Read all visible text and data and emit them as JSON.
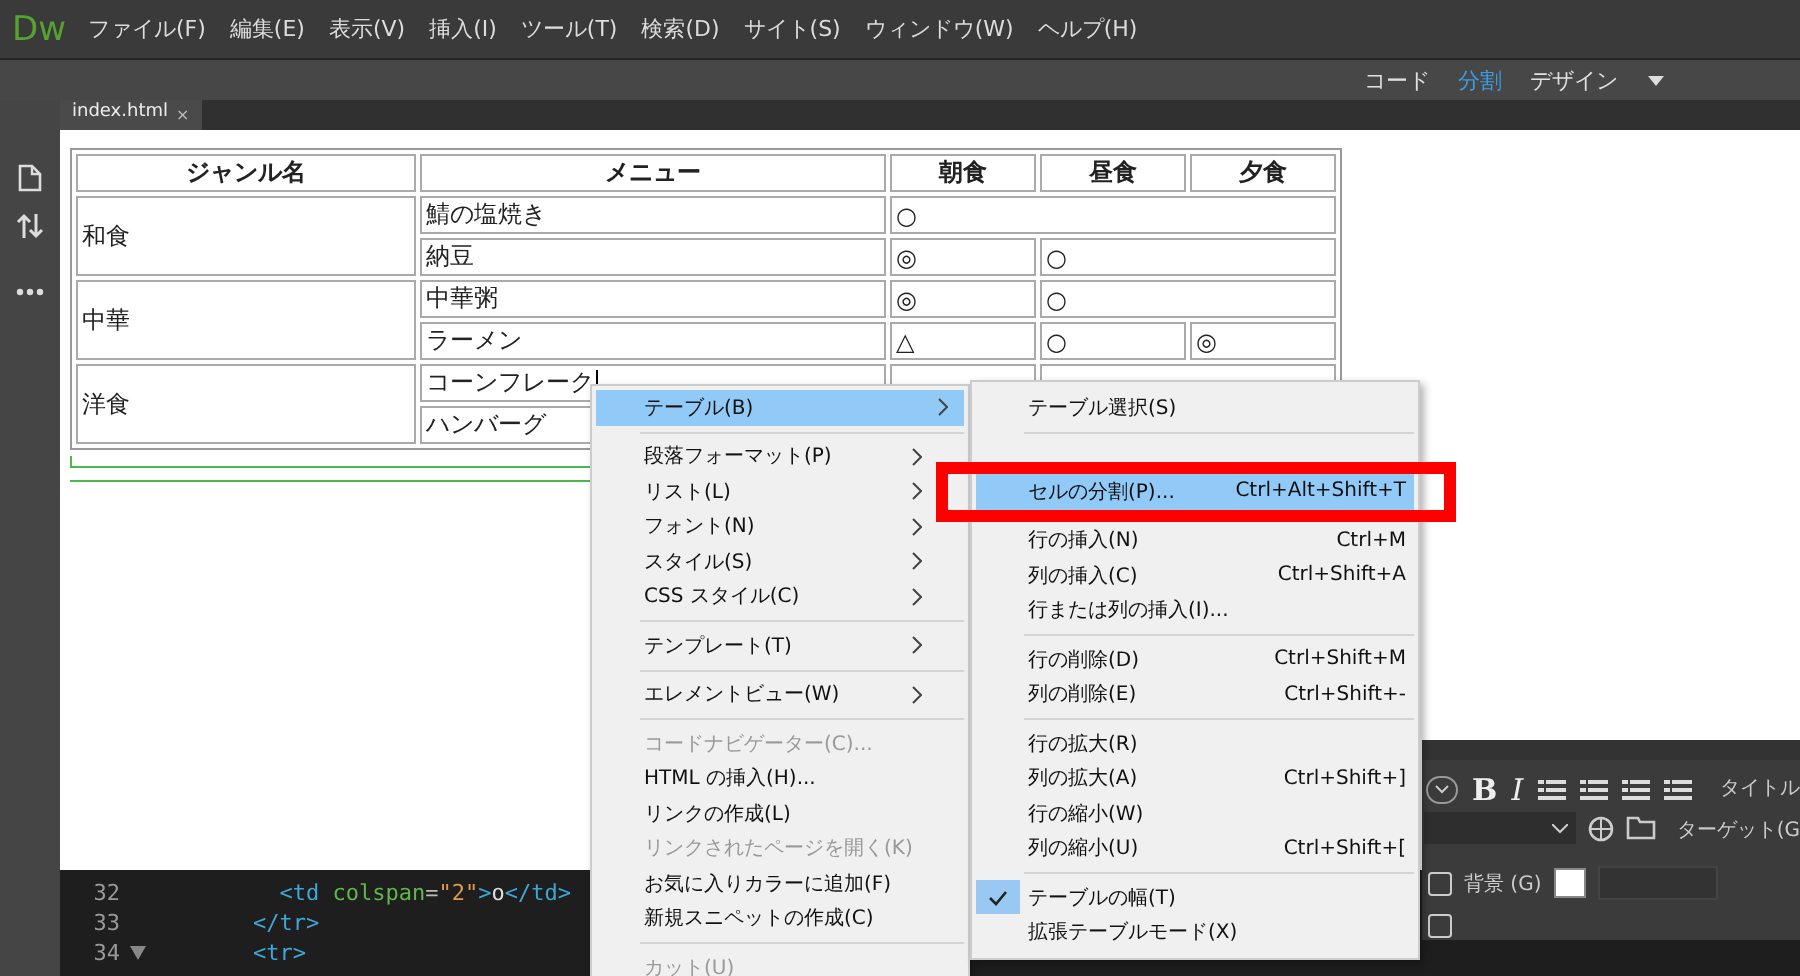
{
  "app": {
    "logo": "Dw"
  },
  "menu_bar": [
    "ファイル(F)",
    "編集(E)",
    "表示(V)",
    "挿入(I)",
    "ツール(T)",
    "検索(D)",
    "サイト(S)",
    "ウィンドウ(W)",
    "ヘルプ(H)"
  ],
  "view_switch": [
    {
      "label": "コード",
      "selected": false
    },
    {
      "label": "分割",
      "selected": true
    },
    {
      "label": "デザイン",
      "selected": false
    }
  ],
  "document_tab": {
    "label": "index.html",
    "close": "×"
  },
  "table": {
    "columns": [
      "ジャンル名",
      "メニュー",
      "朝食",
      "昼食",
      "夕食"
    ],
    "groups": [
      {
        "genre": "和食",
        "rows": [
          {
            "menu": "鯖の塩焼き",
            "cursor": false,
            "cells": [
              {
                "colspan": 3,
                "text": "○"
              }
            ]
          },
          {
            "menu": "納豆",
            "cursor": false,
            "cells": [
              {
                "text": "◎"
              },
              {
                "colspan": 2,
                "text": "○"
              }
            ]
          }
        ]
      },
      {
        "genre": "中華",
        "rows": [
          {
            "menu": "中華粥",
            "cursor": false,
            "cells": [
              {
                "text": "◎"
              },
              {
                "colspan": 2,
                "text": "○"
              }
            ]
          },
          {
            "menu": "ラーメン",
            "cursor": false,
            "cells": [
              {
                "text": "△"
              },
              {
                "text": "○"
              },
              {
                "text": "◎"
              }
            ]
          }
        ]
      },
      {
        "genre": "洋食",
        "rows": [
          {
            "menu": "コーンフレーク",
            "cursor": true,
            "cells": [
              {},
              {
                "colspan": 2
              }
            ]
          },
          {
            "menu": "ハンバーグ",
            "cursor": false
          }
        ]
      }
    ]
  },
  "code_lines": [
    {
      "number": "32",
      "foldable": false,
      "tokens": [
        {
          "kind": "tag",
          "text": "      <td"
        },
        {
          "kind": "attr",
          "text": " colspan"
        },
        {
          "kind": "punct",
          "text": "="
        },
        {
          "kind": "string",
          "text": "\"2\""
        },
        {
          "kind": "tag",
          "text": ">"
        },
        {
          "kind": "text",
          "text": "o"
        },
        {
          "kind": "tag",
          "text": "</td>"
        }
      ]
    },
    {
      "number": "33",
      "foldable": false,
      "tokens": [
        {
          "kind": "tag",
          "text": "    </tr>"
        }
      ]
    },
    {
      "number": "34",
      "foldable": true,
      "tokens": [
        {
          "kind": "tag",
          "text": "    <tr>"
        }
      ]
    }
  ],
  "properties": {
    "bold": "B",
    "italic": "I",
    "title_label": "タイトル",
    "target_label": "ターゲット(G",
    "background_label": "背景 (G)",
    "checkboxes": [
      {
        "checked": false
      },
      {
        "checked": false
      }
    ]
  },
  "context_menu": [
    {
      "kind": "item",
      "label": "テーブル(B)",
      "submenu": true,
      "disabled": false,
      "selected": true
    },
    {
      "kind": "separator"
    },
    {
      "kind": "item",
      "label": "段落フォーマット(P)",
      "submenu": true,
      "disabled": false,
      "selected": false
    },
    {
      "kind": "item",
      "label": "リスト(L)",
      "submenu": true,
      "disabled": false,
      "selected": false
    },
    {
      "kind": "item",
      "label": "フォント(N)",
      "submenu": true,
      "disabled": false,
      "selected": false
    },
    {
      "kind": "item",
      "label": "スタイル(S)",
      "submenu": true,
      "disabled": false,
      "selected": false
    },
    {
      "kind": "item",
      "label": "CSS スタイル(C)",
      "submenu": true,
      "disabled": false,
      "selected": false
    },
    {
      "kind": "separator"
    },
    {
      "kind": "item",
      "label": "テンプレート(T)",
      "submenu": true,
      "disabled": false,
      "selected": false
    },
    {
      "kind": "separator"
    },
    {
      "kind": "item",
      "label": "エレメントビュー(W)",
      "submenu": true,
      "disabled": false,
      "selected": false
    },
    {
      "kind": "separator"
    },
    {
      "kind": "item",
      "label": "コードナビゲーター(C)...",
      "submenu": false,
      "disabled": true,
      "selected": false
    },
    {
      "kind": "item",
      "label": "HTML の挿入(H)...",
      "submenu": false,
      "disabled": false,
      "selected": false
    },
    {
      "kind": "item",
      "label": "リンクの作成(L)",
      "submenu": false,
      "disabled": false,
      "selected": false
    },
    {
      "kind": "item",
      "label": "リンクされたページを開く(K)",
      "submenu": false,
      "disabled": true,
      "selected": false
    },
    {
      "kind": "item",
      "label": "お気に入りカラーに追加(F)",
      "submenu": false,
      "disabled": false,
      "selected": false
    },
    {
      "kind": "item",
      "label": "新規スニペットの作成(C)",
      "submenu": false,
      "disabled": false,
      "selected": false
    },
    {
      "kind": "separator"
    },
    {
      "kind": "item",
      "label": "カット(U)",
      "submenu": false,
      "disabled": true,
      "selected": false
    }
  ],
  "submenu": [
    {
      "kind": "item",
      "label": "テーブル選択(S)",
      "disabled": false,
      "selected": false,
      "checked": false
    },
    {
      "kind": "separator"
    },
    {
      "kind": "covered"
    },
    {
      "kind": "item",
      "label": "セルの分割(P)...",
      "shortcut": "Ctrl+Alt+Shift+T",
      "disabled": false,
      "selected": true,
      "checked": false
    },
    {
      "kind": "separator"
    },
    {
      "kind": "item",
      "label": "行の挿入(N)",
      "shortcut": "Ctrl+M",
      "disabled": false,
      "selected": false,
      "checked": false
    },
    {
      "kind": "item",
      "label": "列の挿入(C)",
      "shortcut": "Ctrl+Shift+A",
      "disabled": false,
      "selected": false,
      "checked": false
    },
    {
      "kind": "item",
      "label": "行または列の挿入(I)...",
      "disabled": false,
      "selected": false,
      "checked": false
    },
    {
      "kind": "separator"
    },
    {
      "kind": "item",
      "label": "行の削除(D)",
      "shortcut": "Ctrl+Shift+M",
      "disabled": false,
      "selected": false,
      "checked": false
    },
    {
      "kind": "item",
      "label": "列の削除(E)",
      "shortcut": "Ctrl+Shift+-",
      "disabled": false,
      "selected": false,
      "checked": false
    },
    {
      "kind": "separator"
    },
    {
      "kind": "item",
      "label": "行の拡大(R)",
      "disabled": false,
      "selected": false,
      "checked": false
    },
    {
      "kind": "item",
      "label": "列の拡大(A)",
      "shortcut": "Ctrl+Shift+]",
      "disabled": false,
      "selected": false,
      "checked": false
    },
    {
      "kind": "item",
      "label": "行の縮小(W)",
      "disabled": false,
      "selected": false,
      "checked": false
    },
    {
      "kind": "item",
      "label": "列の縮小(U)",
      "shortcut": "Ctrl+Shift+[",
      "disabled": false,
      "selected": false,
      "checked": false
    },
    {
      "kind": "separator"
    },
    {
      "kind": "item",
      "label": "テーブルの幅(T)",
      "disabled": false,
      "selected": false,
      "checked": true
    },
    {
      "kind": "item",
      "label": "拡張テーブルモード(X)",
      "disabled": false,
      "selected": false,
      "checked": false
    }
  ]
}
